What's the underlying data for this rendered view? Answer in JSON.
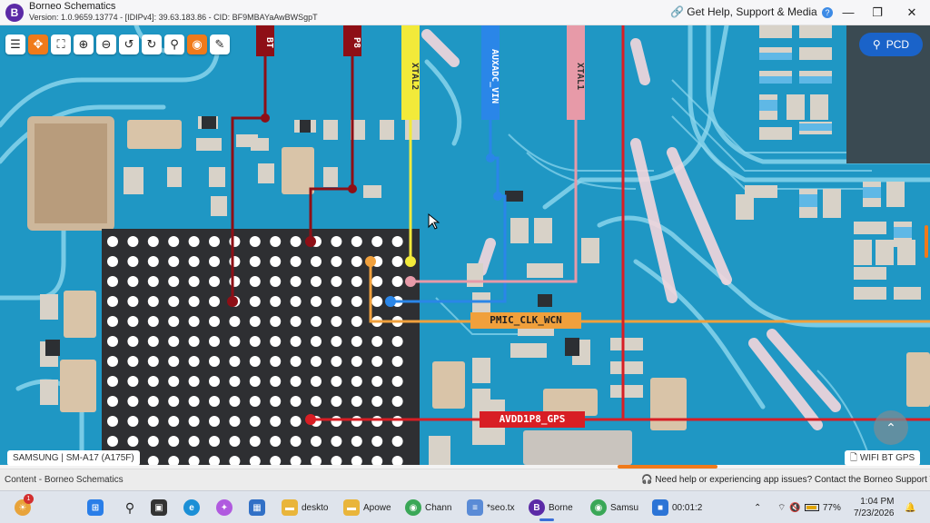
{
  "window": {
    "title": "Borneo Schematics",
    "version": "Version: 1.0.9659.13774 - [IDIPv4]: 39.63.183.86 - CID: BF9MBAYaAwBWSgpT",
    "help_link": "Get Help, Support & Media",
    "help_badge": "?",
    "logo_letter": "B",
    "minimize": "—",
    "maximize": "❐",
    "close": "✕"
  },
  "toolbar": {
    "tools": [
      {
        "name": "list-icon",
        "glyph": "☰"
      },
      {
        "name": "compress-icon",
        "glyph": "✥"
      },
      {
        "name": "fullscreen-icon",
        "glyph": "⛶"
      },
      {
        "name": "zoom-in-icon",
        "glyph": "⊕"
      },
      {
        "name": "zoom-out-icon",
        "glyph": "⊖"
      },
      {
        "name": "rotate-left-icon",
        "glyph": "↺"
      },
      {
        "name": "rotate-right-icon",
        "glyph": "↻"
      },
      {
        "name": "search-icon",
        "glyph": "⚲"
      },
      {
        "name": "mouse-icon",
        "glyph": "◉"
      },
      {
        "name": "draw-icon",
        "glyph": "✎"
      }
    ],
    "pcd_label": "PCD"
  },
  "nets": {
    "xtal2": "XTAL2",
    "auxadc_vin": "AUXADC_VIN",
    "xtal1": "XTAL1",
    "pmic_clk_wcn": "PMIC_CLK_WCN",
    "avdd1p8_gps": "AVDD1P8_GPS",
    "bt_partial": "BT",
    "p8_partial": "P8"
  },
  "colors": {
    "board": "#1f97c4",
    "trace_light": "#8fd8ef",
    "dark_red": "#8e0f16",
    "red": "#d81e24",
    "yellow": "#f2ea3a",
    "blue": "#2a86e8",
    "pink": "#e79aa8",
    "orange": "#f0a03c",
    "bga": "#2e2f32",
    "accent": "#f07a1a"
  },
  "tags": {
    "model": "SAMSUNG | SM-A17 (A175F)",
    "feature": "WIFI BT GPS",
    "scroll_up_glyph": "⌃"
  },
  "status": {
    "left": "Content - Borneo Schematics",
    "right": "Need help or experiencing app issues? Contact the Borneo Support Team."
  },
  "taskbar": {
    "notif_count": "1",
    "items": [
      {
        "label": "deskto"
      },
      {
        "label": "Apowe"
      },
      {
        "label": "Chann"
      },
      {
        "label": "*seo.tx"
      },
      {
        "label": "Borne"
      },
      {
        "label": "Samsu"
      },
      {
        "label": "00:01:2"
      }
    ],
    "battery": "77%",
    "time": "1:04 PM",
    "date": "7/23/2026"
  }
}
